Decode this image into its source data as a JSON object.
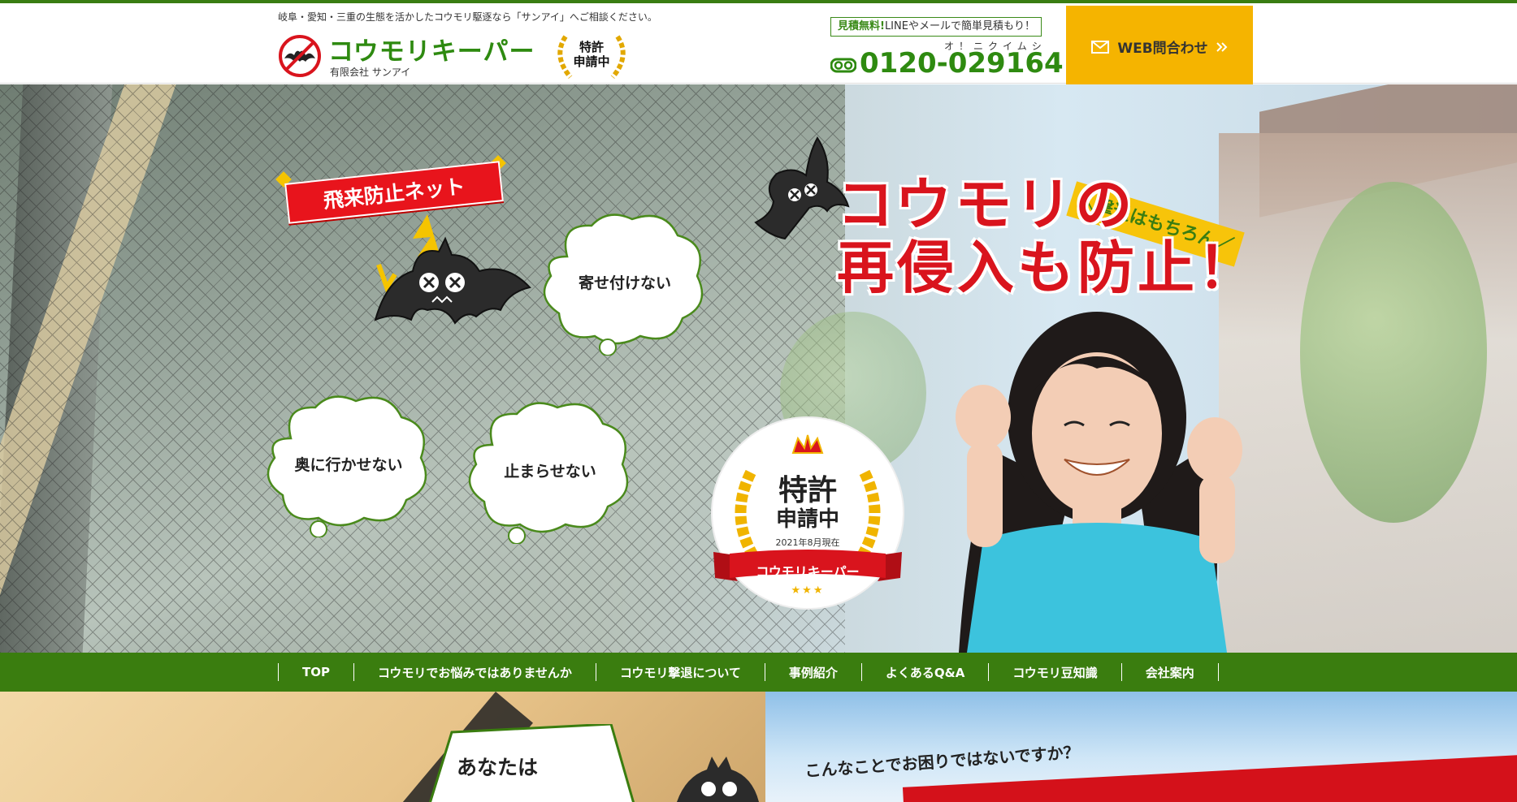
{
  "header": {
    "tagline": "岐阜・愛知・三重の生態を活かしたコウモリ駆逐なら「サンアイ」へご相談ください。",
    "logo_title": "コウモリキーパー",
    "company": "有限会社 サンアイ",
    "patent_badge": "特許\n申請中",
    "estimate_highlight": "見積無料!",
    "estimate_text": "LINEやメールで簡単見積もり！",
    "phone_kana": "オ！ニクイムシ",
    "phone": "0120-029164",
    "web_button": "WEB問合わせ"
  },
  "hero": {
    "net_label": "飛来防止ネット",
    "clouds": [
      "寄せ付けない",
      "奥に行かせない",
      "止まらせない"
    ],
    "ribbon": "＼撃退はもちろん／",
    "headline_line1": "コウモリの",
    "headline_line2": "再侵入も防止！",
    "medal": {
      "line1": "特許",
      "line2": "申請中",
      "date": "2021年8月現在",
      "brand": "コウモリキーパー",
      "stars": "★★★"
    }
  },
  "nav": {
    "items": [
      "TOP",
      "コウモリでお悩みではありませんか",
      "コウモリ撃退について",
      "事例紹介",
      "よくあるQ&A",
      "コウモリ豆知識",
      "会社案内"
    ]
  },
  "sections": {
    "question": "あなたは",
    "trouble_heading": "こんなことでお困りではないですか？"
  },
  "colors": {
    "brand_green": "#2e8a10",
    "nav_green": "#3a7d0f",
    "accent_yellow": "#f5b400",
    "headline_red": "#d9141d"
  },
  "icons": [
    "no-bat-icon",
    "phone-freedial-icon",
    "mail-icon",
    "double-arrow-icon",
    "crown-icon",
    "laurel-icon",
    "bat-icon"
  ]
}
